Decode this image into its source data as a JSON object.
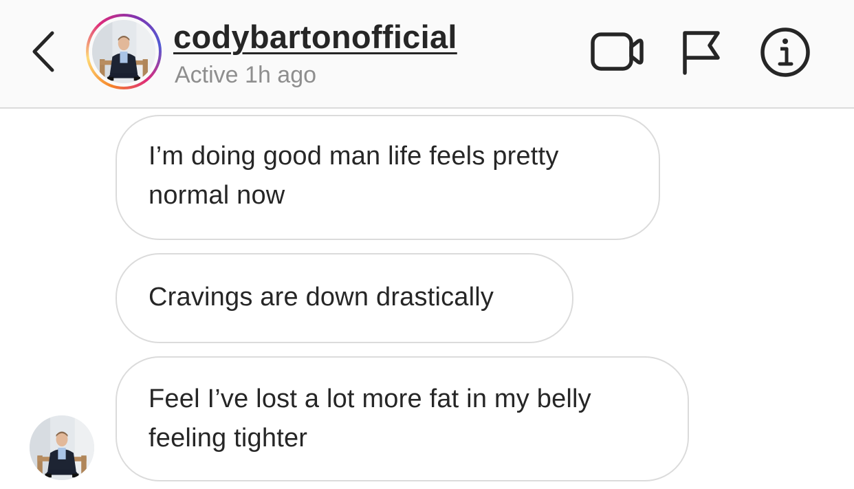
{
  "header": {
    "username": "codybartonofficial",
    "status": "Active 1h ago",
    "back_icon": "chevron-left-icon",
    "video_icon": "video-camera-icon",
    "flag_icon": "flag-icon",
    "info_icon": "info-icon"
  },
  "messages": [
    {
      "text": "I’m doing good man life feels pretty normal now"
    },
    {
      "text": "Cravings are down drastically"
    },
    {
      "text": "Feel I’ve lost a lot more fat in my belly feeling tighter"
    }
  ],
  "colors": {
    "text": "#262626",
    "secondary_text": "#8e8e8e",
    "border": "#dbdbdb",
    "header_bg": "#fafafa"
  }
}
